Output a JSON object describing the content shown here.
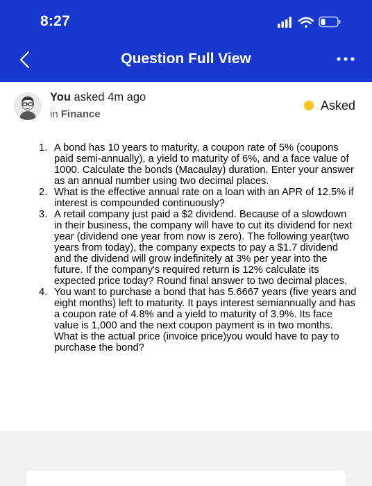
{
  "status_bar": {
    "time": "8:27"
  },
  "nav": {
    "title": "Question Full View"
  },
  "question_meta": {
    "asker": "You",
    "asked_text": "asked 4m ago",
    "subject_prefix": "in",
    "subject": "Finance",
    "status": "Asked",
    "status_color": "#f5c518"
  },
  "question": {
    "items": [
      {
        "number": "1.",
        "text": "A bond has 10 years to maturity, a coupon rate of 5% (coupons paid semi-annually), a yield to maturity of 6%, and a face value of 1000. Calculate the bonds (Macaulay) duration. Enter your answer as an annual number using two decimal places."
      },
      {
        "number": "2.",
        "text": "What is the effective annual rate on a loan with an APR of 12.5% if interest is compounded continuously?"
      },
      {
        "number": "3.",
        "text": "A retail company just paid a $2 dividend. Because of a slowdown in their business, the company will have to cut its dividend for next year (dividend one year from now is zero). The following year(two years from today), the company expects to pay a $1.7 dividend and the dividend will grow indefinitely at 3% per year into the future. If the company's required return is 12% calculate its expected price today? Round final answer to two decimal places."
      },
      {
        "number": "4.",
        "text": "You want to purchase a bond that has 5.6667 years (five years and eight months) left to maturity. It pays interest semiannually and has a coupon rate of 4.8% and a yield to maturity of 3.9%. Its face value is 1,000 and the next coupon payment is in two months. What is the actual price (invoice price)you would have to pay to purchase the bond?"
      }
    ]
  },
  "colors": {
    "header_blue": "#1638cf",
    "status_yellow": "#f5c518"
  },
  "icons": {
    "back": "chevron-left-icon",
    "more": "more-dots-icon",
    "signal": "cellular-signal-icon",
    "wifi": "wifi-icon",
    "battery": "battery-icon",
    "avatar": "user-avatar"
  }
}
